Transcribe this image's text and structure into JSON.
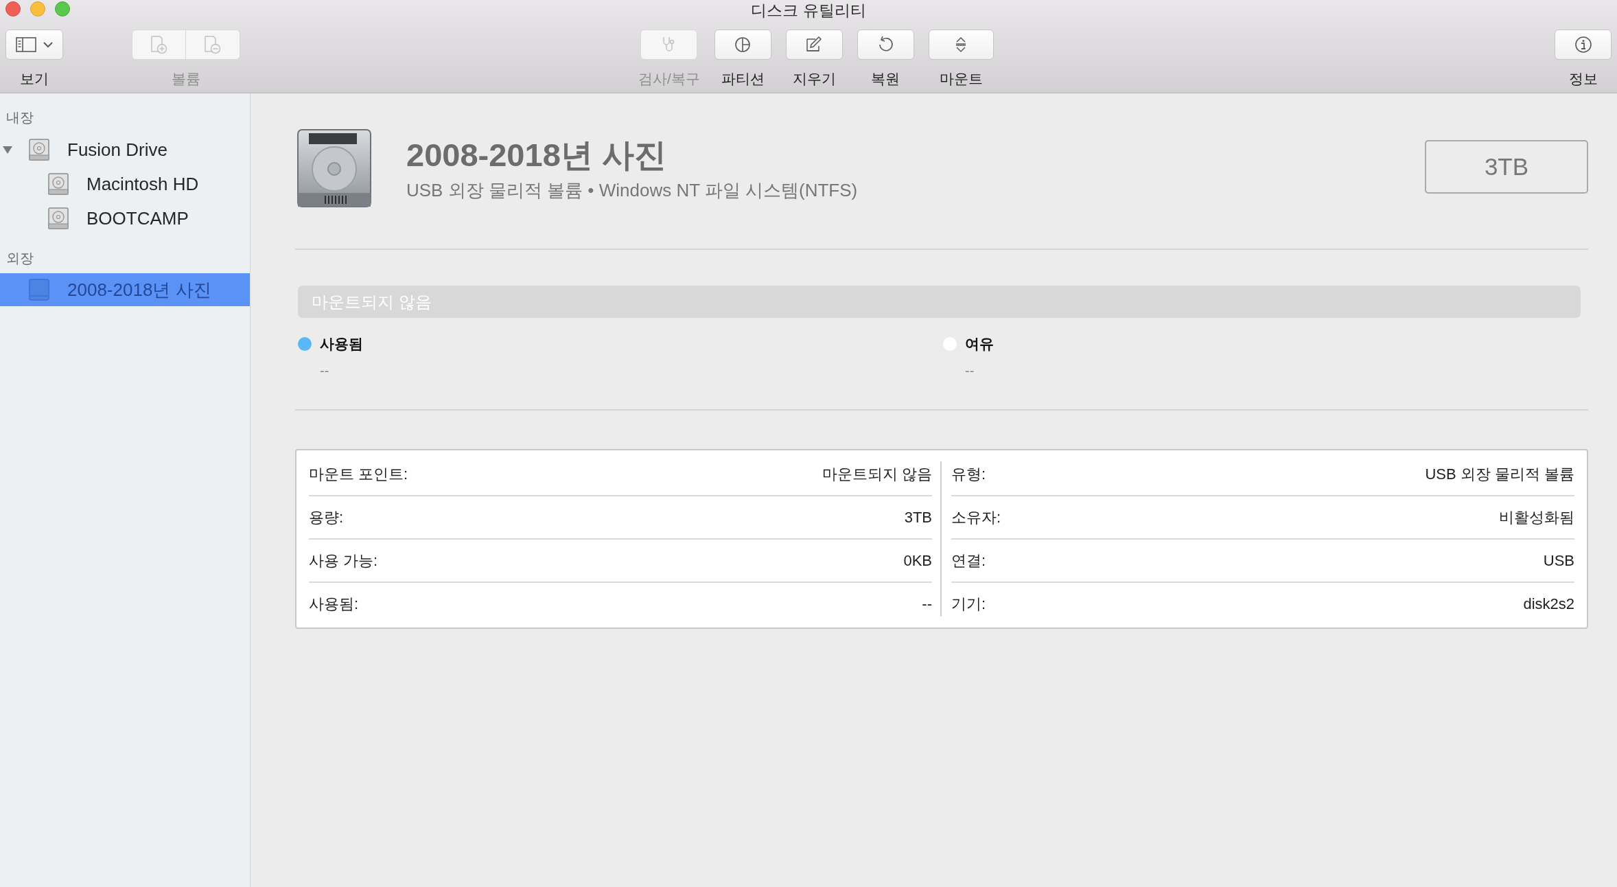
{
  "window": {
    "title": "디스크 유틸리티"
  },
  "toolbar": {
    "left": [
      {
        "kind": "view",
        "label": "보기",
        "disabled": false
      },
      {
        "kind": "volume",
        "label": "볼륨",
        "disabled": true
      }
    ],
    "center": [
      {
        "kind": "firstaid",
        "label": "검사/복구",
        "disabled": true
      },
      {
        "kind": "partition",
        "label": "파티션",
        "disabled": false
      },
      {
        "kind": "erase",
        "label": "지우기",
        "disabled": false
      },
      {
        "kind": "restore",
        "label": "복원",
        "disabled": false
      },
      {
        "kind": "mount",
        "label": "마운트",
        "disabled": false
      }
    ],
    "right": [
      {
        "kind": "info",
        "label": "정보",
        "disabled": false
      }
    ]
  },
  "sidebar": {
    "sections": [
      {
        "heading": "내장",
        "items": [
          {
            "name": "Fusion Drive",
            "kind": "internal",
            "selected": false,
            "expanded": true,
            "children": [
              {
                "name": "Macintosh HD",
                "kind": "internal",
                "selected": false
              },
              {
                "name": "BOOTCAMP",
                "kind": "internal",
                "selected": false
              }
            ]
          }
        ]
      },
      {
        "heading": "외장",
        "items": [
          {
            "name": "2008-2018년 사진",
            "kind": "external",
            "selected": true
          }
        ]
      }
    ]
  },
  "header": {
    "name": "2008-2018년 사진",
    "subtitle": "USB 외장 물리적 볼륨 • Windows NT 파일 시스템(NTFS)",
    "capacity": "3TB"
  },
  "usage": {
    "bar_label": "마운트되지 않음",
    "legend": [
      {
        "label": "사용됨",
        "color": "#5ab8f6",
        "value": "--"
      },
      {
        "label": "여유",
        "color": "#ffffff",
        "value": "--"
      }
    ]
  },
  "info": {
    "left": [
      {
        "label": "마운트 포인트:",
        "value": "마운트되지 않음"
      },
      {
        "label": "용량:",
        "value": "3TB"
      },
      {
        "label": "사용 가능:",
        "value": "0KB"
      },
      {
        "label": "사용됨:",
        "value": "--"
      }
    ],
    "right": [
      {
        "label": "유형:",
        "value": "USB 외장 물리적 볼륨"
      },
      {
        "label": "소유자:",
        "value": "비활성화됨"
      },
      {
        "label": "연결:",
        "value": "USB"
      },
      {
        "label": "기기:",
        "value": "disk2s2"
      }
    ]
  }
}
